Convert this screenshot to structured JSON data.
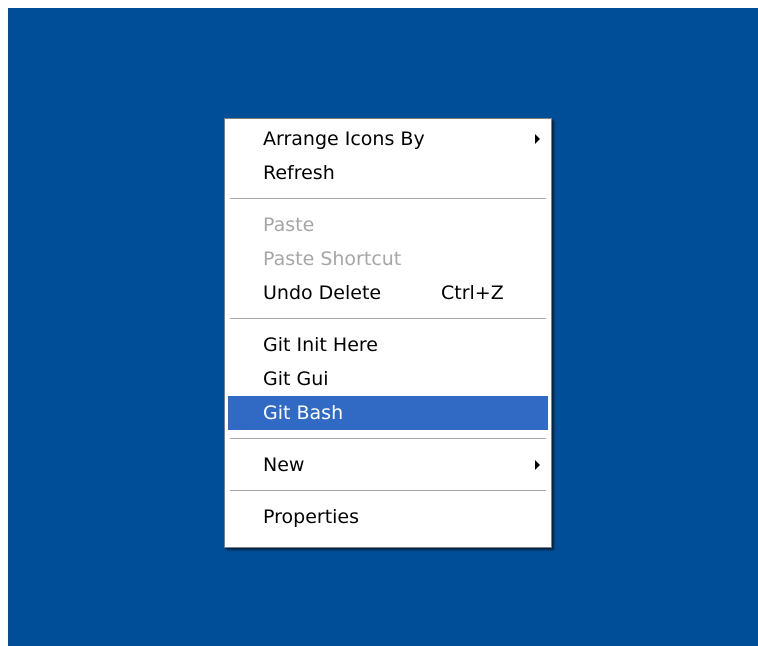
{
  "colors": {
    "desktop": "#004e98",
    "menu_background": "#ffffff",
    "highlight": "#316ac5",
    "disabled_text": "#a6a6a6"
  },
  "menu": {
    "arrange_icons_by": {
      "label": "Arrange Icons By",
      "submenu_icon": "arrow-right-icon"
    },
    "refresh": {
      "label": "Refresh"
    },
    "paste": {
      "label": "Paste",
      "disabled": true
    },
    "paste_shortcut": {
      "label": "Paste Shortcut",
      "disabled": true
    },
    "undo_delete": {
      "label": "Undo Delete",
      "shortcut": "Ctrl+Z"
    },
    "git_init_here": {
      "label": "Git Init Here"
    },
    "git_gui": {
      "label": "Git Gui"
    },
    "git_bash": {
      "label": "Git Bash",
      "highlighted": true
    },
    "new": {
      "label": "New",
      "submenu_icon": "arrow-right-icon"
    },
    "properties": {
      "label": "Properties"
    }
  }
}
